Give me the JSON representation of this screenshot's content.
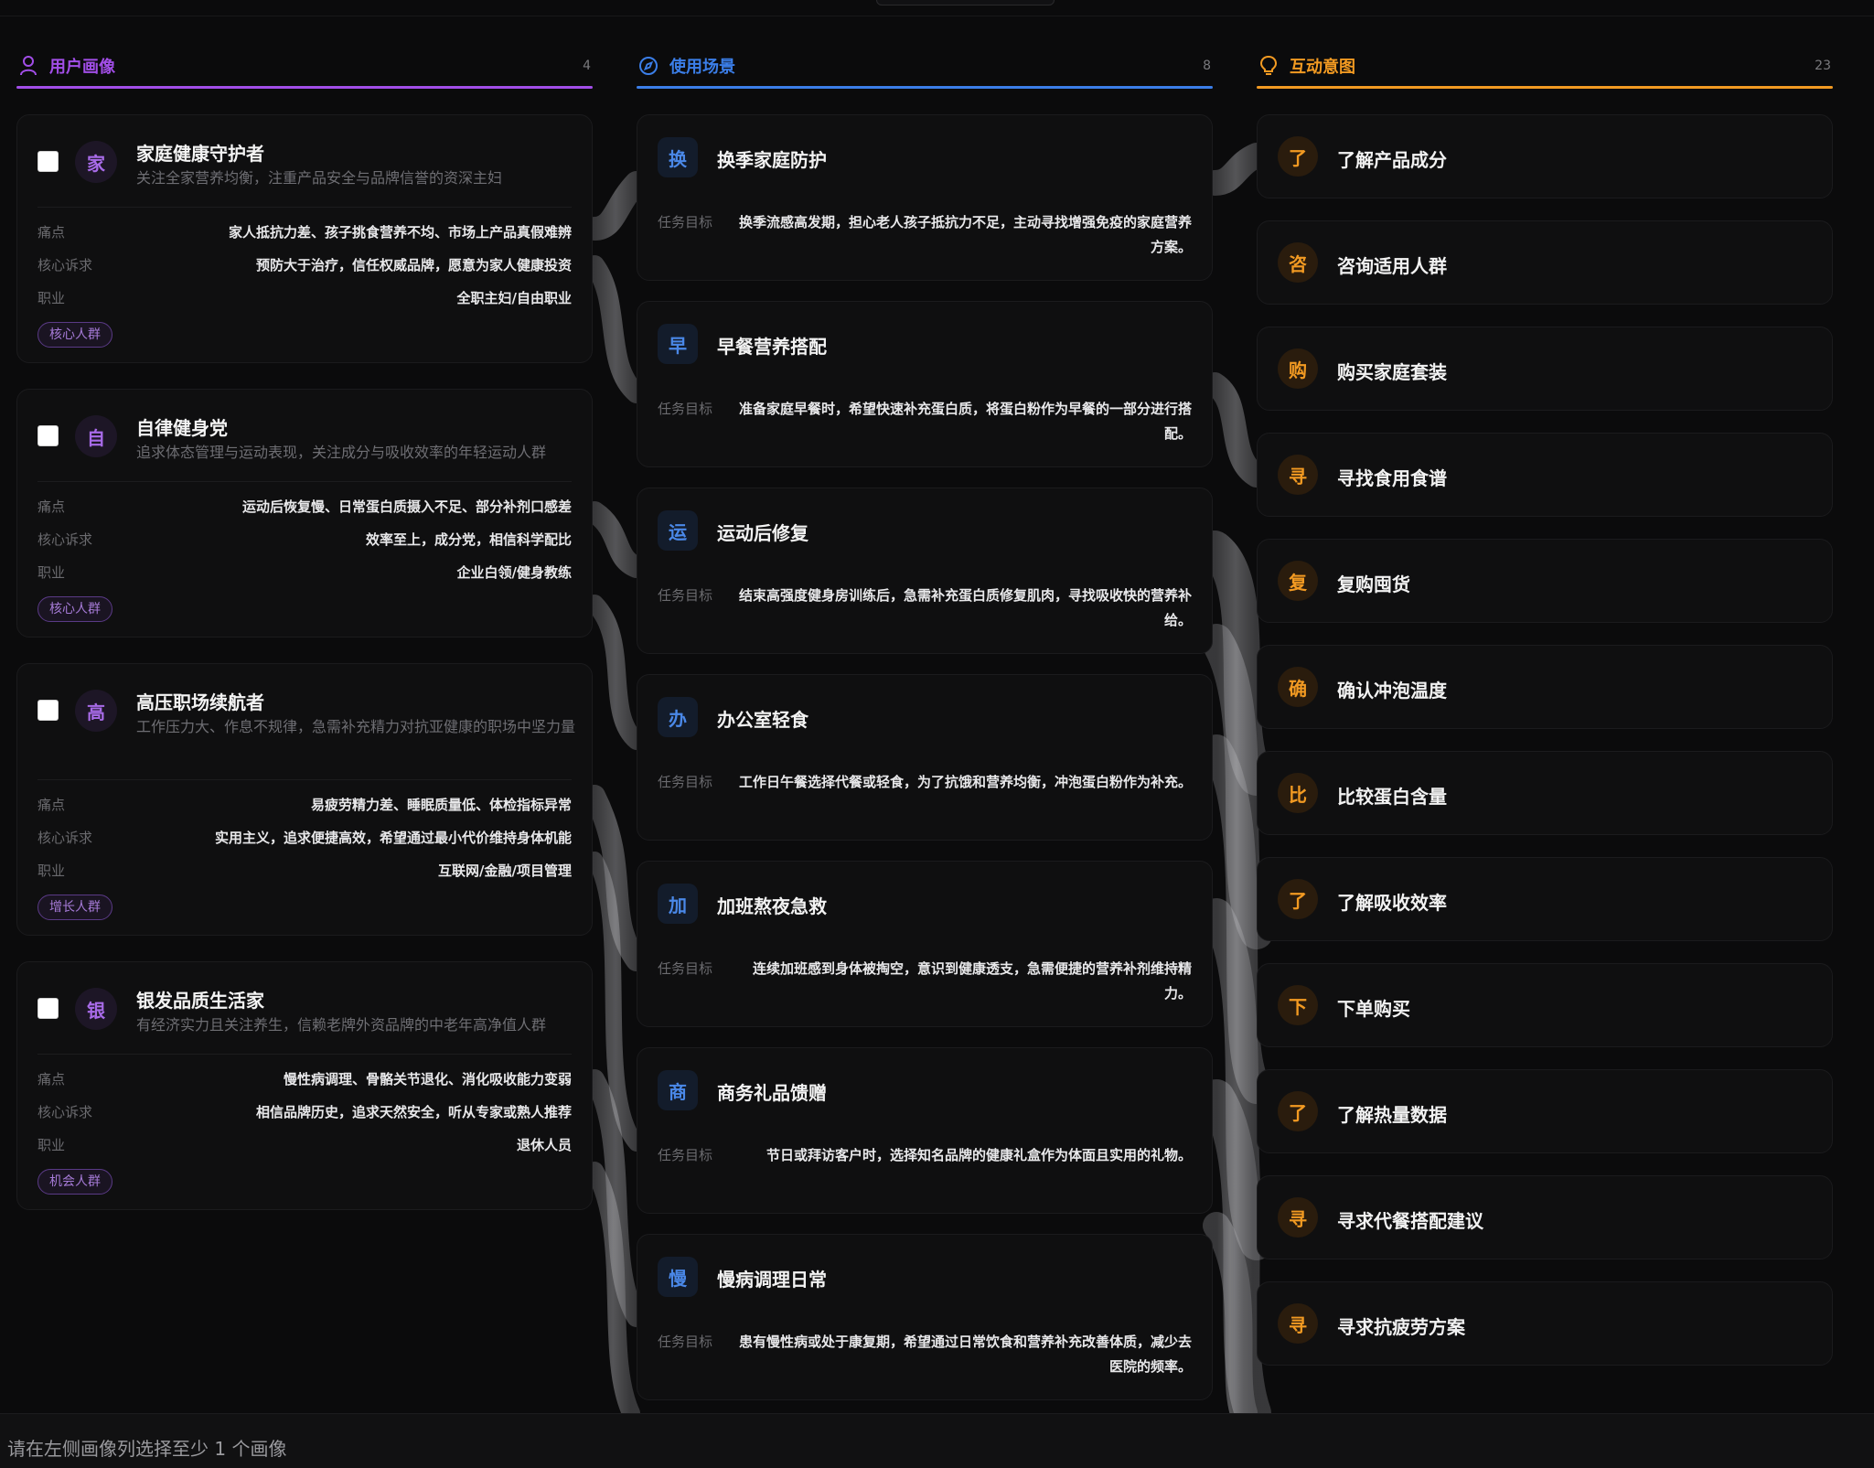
{
  "colors": {
    "personas_accent": "#a24ee8",
    "scenes_accent": "#3b7ee8",
    "intents_accent": "#f29a22",
    "background": "#0b0b0c"
  },
  "columns": {
    "personas": {
      "title": "用户画像",
      "count": "4",
      "icon": "user-icon"
    },
    "scenes": {
      "title": "使用场景",
      "count": "8",
      "icon": "compass-icon"
    },
    "intents": {
      "title": "互动意图",
      "count": "23",
      "icon": "lightbulb-icon"
    }
  },
  "personas": [
    {
      "avatar": "家",
      "name": "家庭健康守护者",
      "desc": "关注全家营养均衡，注重产品安全与品牌信誉的资深主妇",
      "rows": [
        {
          "label": "痛点",
          "value": "家人抵抗力差、孩子挑食营养不均、市场上产品真假难辨"
        },
        {
          "label": "核心诉求",
          "value": "预防大于治疗，信任权威品牌，愿意为家人健康投资"
        },
        {
          "label": "职业",
          "value": "全职主妇/自由职业"
        }
      ],
      "tag": "核心人群"
    },
    {
      "avatar": "自",
      "name": "自律健身党",
      "desc": "追求体态管理与运动表现，关注成分与吸收效率的年轻运动人群",
      "rows": [
        {
          "label": "痛点",
          "value": "运动后恢复慢、日常蛋白质摄入不足、部分补剂口感差"
        },
        {
          "label": "核心诉求",
          "value": "效率至上，成分党，相信科学配比"
        },
        {
          "label": "职业",
          "value": "企业白领/健身教练"
        }
      ],
      "tag": "核心人群"
    },
    {
      "avatar": "高",
      "name": "高压职场续航者",
      "desc": "工作压力大、作息不规律，急需补充精力对抗亚健康的职场中坚力量",
      "rows": [
        {
          "label": "痛点",
          "value": "易疲劳精力差、睡眠质量低、体检指标异常"
        },
        {
          "label": "核心诉求",
          "value": "实用主义，追求便捷高效，希望通过最小代价维持身体机能"
        },
        {
          "label": "职业",
          "value": "互联网/金融/项目管理"
        }
      ],
      "tag": "增长人群"
    },
    {
      "avatar": "银",
      "name": "银发品质生活家",
      "desc": "有经济实力且关注养生，信赖老牌外资品牌的中老年高净值人群",
      "rows": [
        {
          "label": "痛点",
          "value": "慢性病调理、骨骼关节退化、消化吸收能力变弱"
        },
        {
          "label": "核心诉求",
          "value": "相信品牌历史，追求天然安全，听从专家或熟人推荐"
        },
        {
          "label": "职业",
          "value": "退休人员"
        }
      ],
      "tag": "机会人群"
    }
  ],
  "scenes": [
    {
      "icon": "换",
      "name": "换季家庭防护",
      "label": "任务目标",
      "goal": "换季流感高发期，担心老人孩子抵抗力不足，主动寻找增强免疫的家庭营养方案。"
    },
    {
      "icon": "早",
      "name": "早餐营养搭配",
      "label": "任务目标",
      "goal": "准备家庭早餐时，希望快速补充蛋白质，将蛋白粉作为早餐的一部分进行搭配。"
    },
    {
      "icon": "运",
      "name": "运动后修复",
      "label": "任务目标",
      "goal": "结束高强度健身房训练后，急需补充蛋白质修复肌肉，寻找吸收快的营养补给。"
    },
    {
      "icon": "办",
      "name": "办公室轻食",
      "label": "任务目标",
      "goal": "工作日午餐选择代餐或轻食，为了抗饿和营养均衡，冲泡蛋白粉作为补充。"
    },
    {
      "icon": "加",
      "name": "加班熬夜急救",
      "label": "任务目标",
      "goal": "连续加班感到身体被掏空，意识到健康透支，急需便捷的营养补剂维持精力。"
    },
    {
      "icon": "商",
      "name": "商务礼品馈赠",
      "label": "任务目标",
      "goal": "节日或拜访客户时，选择知名品牌的健康礼盒作为体面且实用的礼物。"
    },
    {
      "icon": "慢",
      "name": "慢病调理日常",
      "label": "任务目标",
      "goal": "患有慢性病或处于康复期，希望通过日常饮食和营养补充改善体质，减少去医院的频率。"
    }
  ],
  "intents": [
    {
      "icon": "了",
      "name": "了解产品成分"
    },
    {
      "icon": "咨",
      "name": "咨询适用人群"
    },
    {
      "icon": "购",
      "name": "购买家庭套装"
    },
    {
      "icon": "寻",
      "name": "寻找食用食谱"
    },
    {
      "icon": "复",
      "name": "复购囤货"
    },
    {
      "icon": "确",
      "name": "确认冲泡温度"
    },
    {
      "icon": "比",
      "name": "比较蛋白含量"
    },
    {
      "icon": "了",
      "name": "了解吸收效率"
    },
    {
      "icon": "下",
      "name": "下单购买"
    },
    {
      "icon": "了",
      "name": "了解热量数据"
    },
    {
      "icon": "寻",
      "name": "寻求代餐搭配建议"
    },
    {
      "icon": "寻",
      "name": "寻求抗疲劳方案"
    }
  ],
  "footer": {
    "hint": "请在左侧画像列选择至少 1 个画像"
  }
}
